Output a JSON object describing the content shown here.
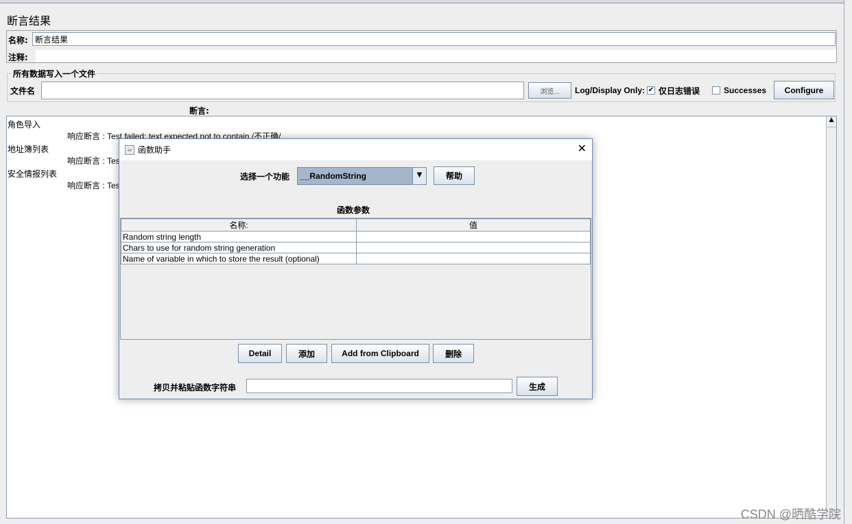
{
  "page": {
    "title": "断言结果",
    "name_label": "名称:",
    "name_value": "断言结果",
    "comment_label": "注释:"
  },
  "file_group": {
    "legend": "所有数据写入一个文件",
    "filename_label": "文件名",
    "filename_value": "",
    "browse": "浏览...",
    "log_display": "Log/Display Only:",
    "errors_only": "仅日志错误",
    "errors_checked": true,
    "successes": "Successes",
    "successes_checked": false,
    "configure": "Configure"
  },
  "assertions_label": "断言:",
  "results": [
    {
      "sampler": "角色导入",
      "assertion": "响应断言 : Test failed: text expected not to contain /不正确/"
    },
    {
      "sampler": "地址簿列表",
      "assertion": "响应断言 : Tes"
    },
    {
      "sampler": "安全情报列表",
      "assertion": "响应断言 : Tes"
    }
  ],
  "dialog": {
    "title": "函数助手",
    "select_label": "选择一个功能",
    "selected_function": "__RandomString",
    "help": "帮助",
    "params_title": "函数参数",
    "columns": [
      "名称:",
      "值"
    ],
    "rows": [
      [
        "Random string length",
        ""
      ],
      [
        "Chars to use for random string generation",
        ""
      ],
      [
        "Name of variable in which to store the result (optional)",
        ""
      ]
    ],
    "buttons": {
      "detail": "Detail",
      "add": "添加",
      "clipboard": "Add from Clipboard",
      "delete": "删除"
    },
    "copy_label": "拷贝并粘贴函数字符串",
    "copy_value": "",
    "generate": "生成"
  },
  "watermark": "CSDN @晒酷学院"
}
